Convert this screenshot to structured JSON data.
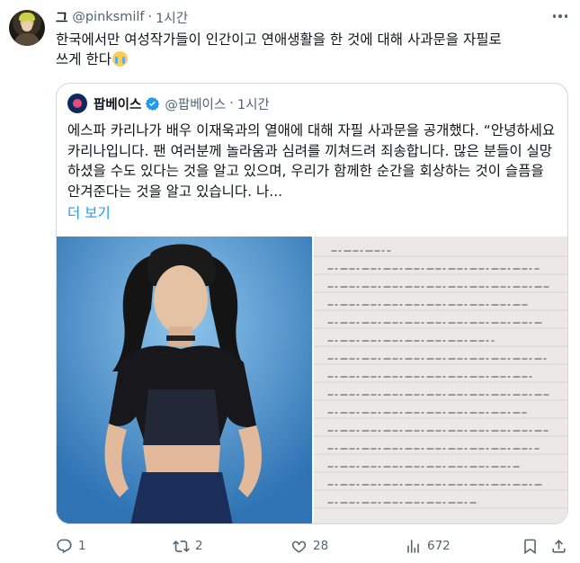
{
  "tweet": {
    "display_name": "그",
    "handle": "@pinksmilf",
    "separator": "·",
    "time": "1시간",
    "text_line1": "한국에서만 여성작가들이 인간이고 연애생활을 한 것에 대해 사과문을 자필로",
    "text_line2": "쓰게 한다",
    "emoji": "loudly-crying-face"
  },
  "quote": {
    "display_name": "팝베이스",
    "verified": true,
    "handle": "@팝베이스",
    "separator": "·",
    "time": "1시간",
    "text": "에스파 카리나가 배우 이재욱과의 열애에 대해 자필 사과문을 공개했다. “안녕하세요 카리나입니다. 팬 여러분께 놀라움과 심려를 끼쳐드려 죄송합니다. 많은 분들이 실망하셨을 수도 있다는 것을 알고 있으며, 우리가 함께한 순간을 회상하는 것이 슬픔을 안겨준다는 것을 알고 있습니다. 나...",
    "show_more": "더 보기",
    "media": [
      "photo-portrait",
      "handwritten-letter-photo"
    ]
  },
  "actions": {
    "replies": "1",
    "reposts": "2",
    "likes": "28",
    "views": "672"
  },
  "colors": {
    "accent": "#1d9bf0",
    "muted": "#536471",
    "border": "#cfd9de",
    "text": "#0f1419"
  }
}
